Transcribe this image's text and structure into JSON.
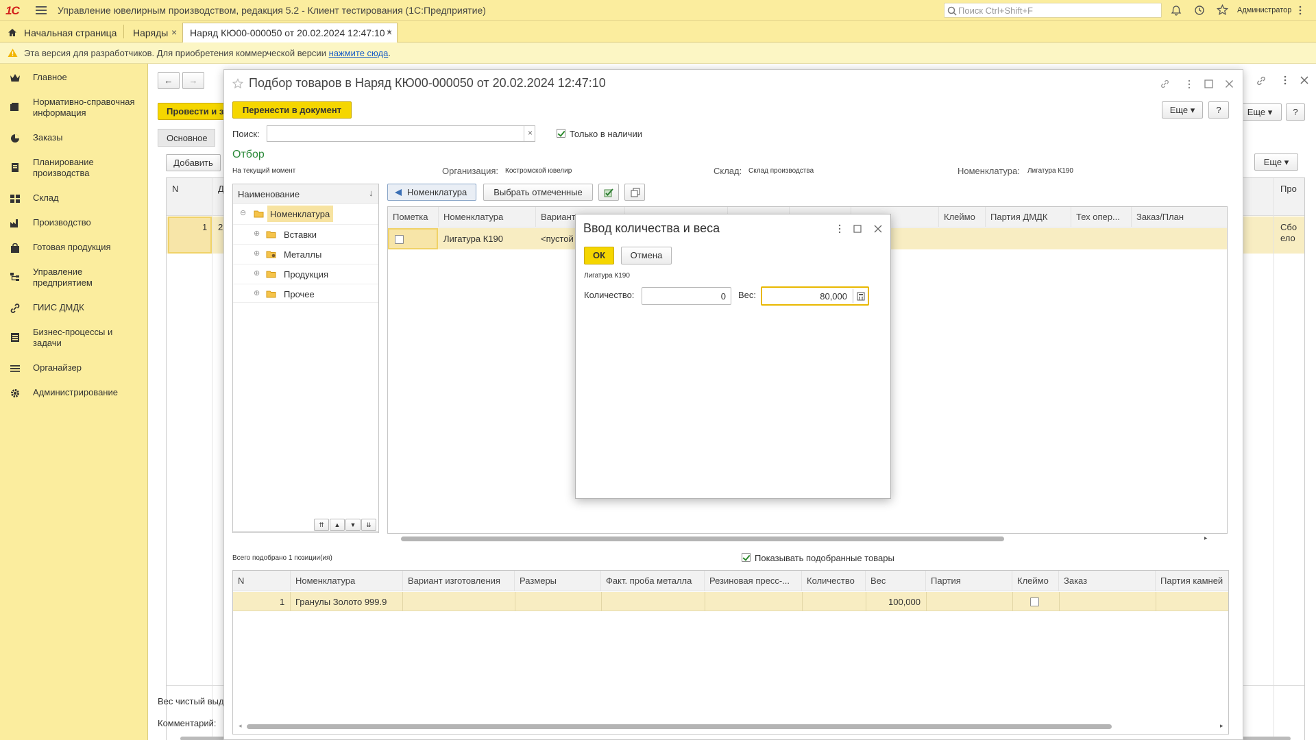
{
  "app": {
    "logo": "1С",
    "title": "Управление ювелирным производством, редакция 5.2  - Клиент тестирования (1С:Предприятие)",
    "search_placeholder": "Поиск Ctrl+Shift+F",
    "user": "Администратор"
  },
  "tabs": [
    {
      "label": "Начальная страница"
    },
    {
      "label": "Наряды"
    },
    {
      "label": "Наряд КЮ00-000050 от 20.02.2024 12:47:10 *"
    }
  ],
  "warning": {
    "text": "Эта версия для разработчиков. Для приобретения коммерческой версии ",
    "link": "нажмите сюда",
    "suffix": "."
  },
  "sidebar": {
    "items": [
      {
        "label": "Главное",
        "icon": "crown-icon"
      },
      {
        "label": "Нормативно-справочная информация",
        "icon": "book-icon"
      },
      {
        "label": "Заказы",
        "icon": "pie-chart-icon"
      },
      {
        "label": "Планирование производства",
        "icon": "clipboard-icon"
      },
      {
        "label": "Склад",
        "icon": "grid-icon"
      },
      {
        "label": "Производство",
        "icon": "factory-icon"
      },
      {
        "label": "Готовая продукция",
        "icon": "bag-icon"
      },
      {
        "label": "Управление предприятием",
        "icon": "org-icon"
      },
      {
        "label": "ГИИС ДМДК",
        "icon": "link-icon"
      },
      {
        "label": "Бизнес-процессы и задачи",
        "icon": "process-icon"
      },
      {
        "label": "Органайзер",
        "icon": "list-icon"
      },
      {
        "label": "Администрирование",
        "icon": "gear-icon"
      }
    ]
  },
  "background_doc": {
    "post_button": "Провести и з",
    "tab_main": "Основное",
    "add_button": "Добавить",
    "more_button": "Еще",
    "col_n": "N",
    "col_d": "Д",
    "col_right": "Про",
    "row_n": "1",
    "row_d": "2",
    "row_right1": "Сбо",
    "row_right2": "ело",
    "weight_label": "Вес чистый выд",
    "comment_label": "Комментарий:"
  },
  "selection": {
    "title": "Подбор товаров в Наряд КЮ00-000050 от 20.02.2024 12:47:10",
    "transfer_button": "Перенести в документ",
    "more_button": "Еще",
    "help_button": "?",
    "search_label": "Поиск:",
    "search_value": "",
    "only_available_label": "Только в наличии",
    "filter_title": "Отбор",
    "filter_moment": "На текущий момент",
    "org_label": "Организация:",
    "org_value": "Костромской ювелир",
    "warehouse_label": "Склад:",
    "warehouse_value": "Склад производства",
    "nomen_label": "Номенклатура:",
    "nomen_value": "Лигатура К190",
    "tree_header": "Наименование",
    "tree": [
      {
        "label": "Номенклатура",
        "root": true
      },
      {
        "label": "Вставки"
      },
      {
        "label": "Металлы"
      },
      {
        "label": "Продукция"
      },
      {
        "label": "Прочее"
      }
    ],
    "nomen_button": "Номенклатура",
    "select_marked_button": "Выбрать отмеченные",
    "goods_columns": [
      "Пометка",
      "Номенклатура",
      "Вариант",
      "",
      "",
      "",
      "Партия",
      "Клеймо",
      "Партия ДМДК",
      "Тех опер...",
      "Заказ/План"
    ],
    "goods_row": {
      "nomen": "Лигатура К190",
      "variant": "<пустой"
    },
    "total_label": "Всего подобрано 1 позиции(ия)",
    "show_selected_label": "Показывать подобранные товары",
    "selected_columns": [
      "N",
      "Номенклатура",
      "Вариант изготовления",
      "Размеры",
      "Факт. проба металла",
      "Резиновая пресс-...",
      "Количество",
      "Вес",
      "Партия",
      "Клеймо",
      "Заказ",
      "Партия камней"
    ],
    "selected_row": {
      "n": "1",
      "nomen": "Гранулы Золото 999.9",
      "weight": "100,000"
    }
  },
  "dialog": {
    "title": "Ввод количества и веса",
    "ok_button": "ОК",
    "cancel_button": "Отмена",
    "item_name": "Лигатура К190",
    "qty_label": "Количество:",
    "qty_value": "0",
    "weight_label": "Вес:",
    "weight_value": "80,000"
  },
  "colors": {
    "accent_yellow": "#fbed9e",
    "button_yellow": "#f5d600",
    "selection_row": "#f8edc2",
    "focus_border": "#e9b800",
    "green_title": "#2c8a3a"
  }
}
